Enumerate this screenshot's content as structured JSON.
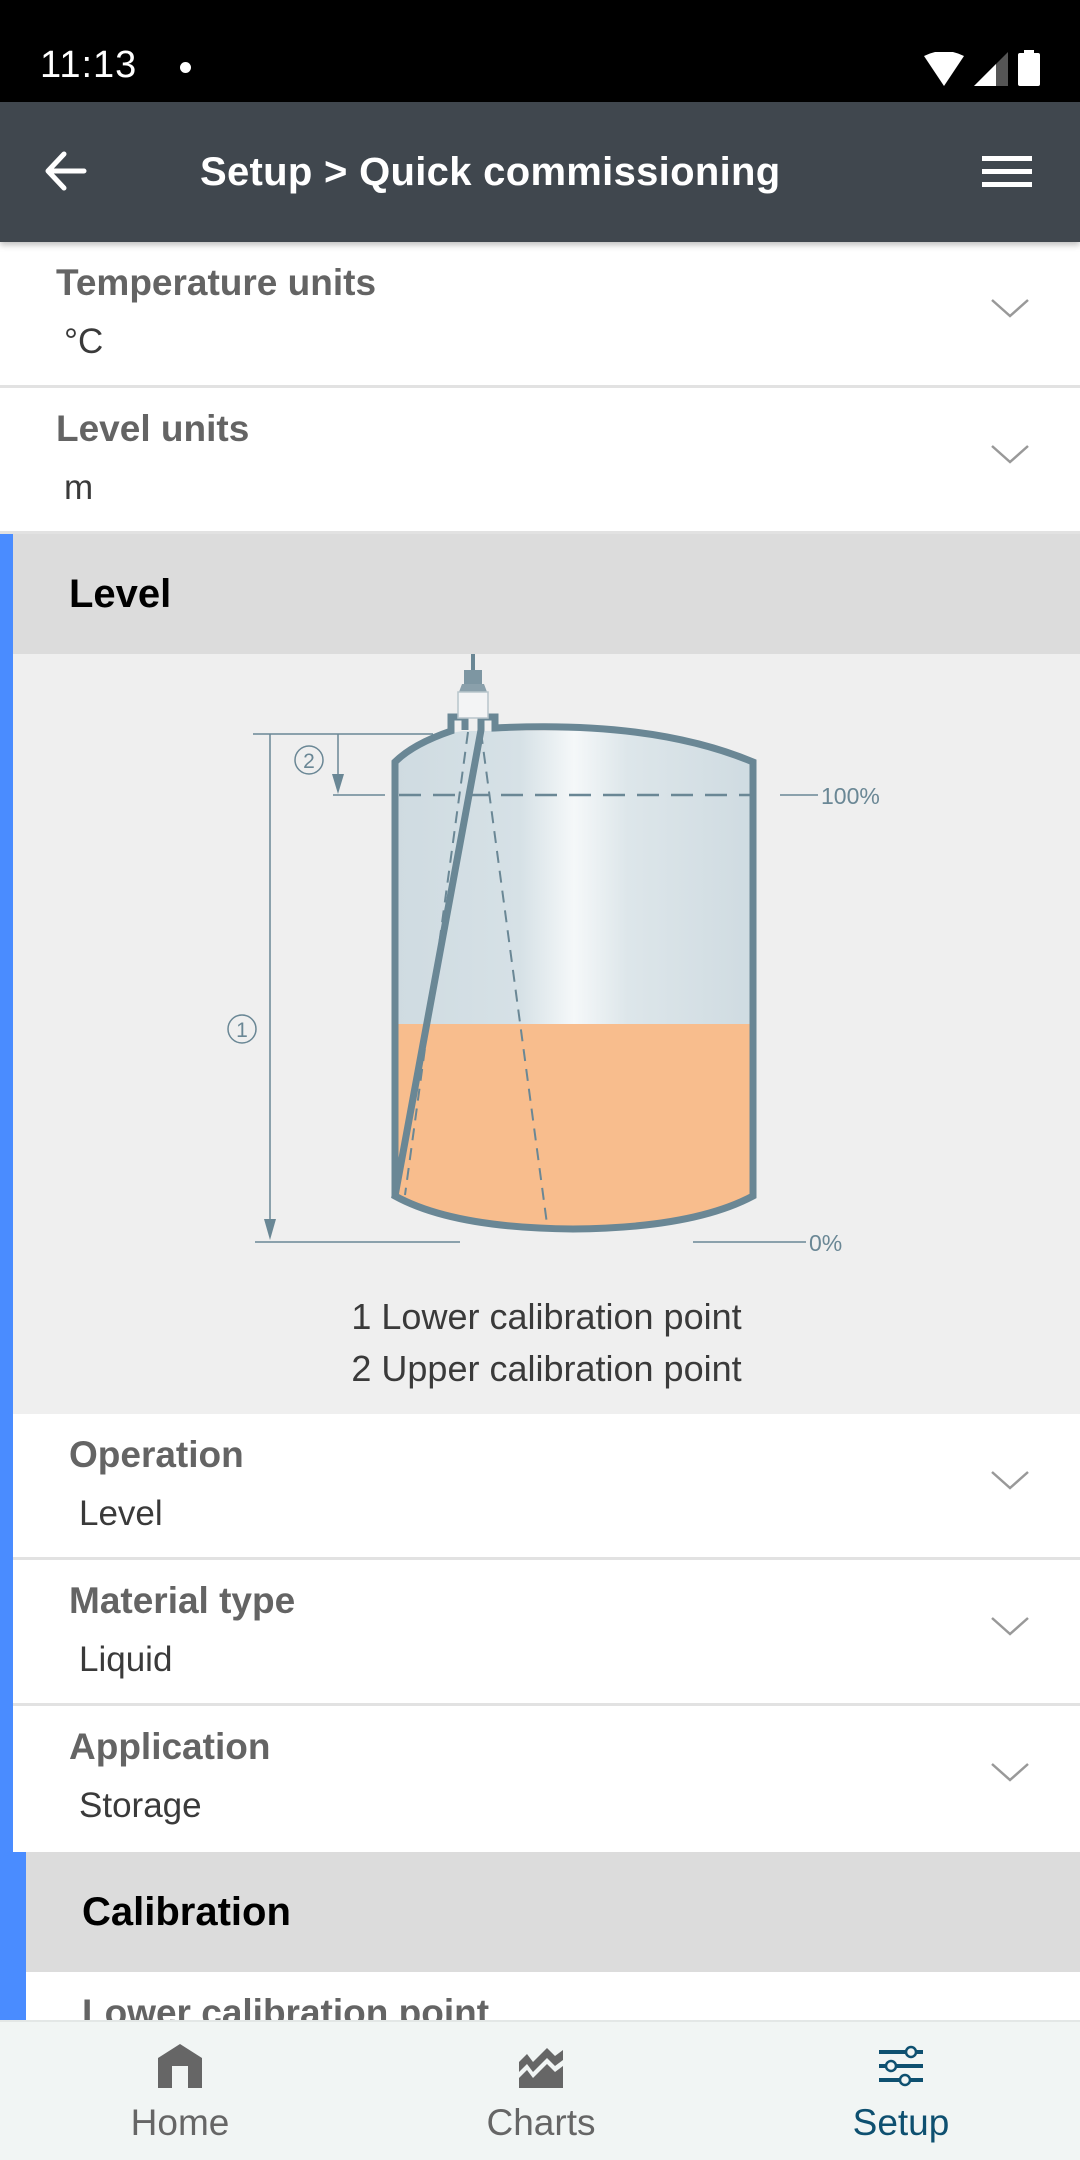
{
  "status_bar": {
    "time": "11:13",
    "icons": [
      "notification-dot",
      "wifi-icon",
      "signal-icon",
      "battery-icon"
    ]
  },
  "app_bar": {
    "title": "Setup > Quick commissioning",
    "back_icon": "arrow-left-icon",
    "menu_icon": "hamburger-menu-icon"
  },
  "fields_top": [
    {
      "label": "Temperature units",
      "value": "°C"
    },
    {
      "label": "Level units",
      "value": "m"
    }
  ],
  "level_section": {
    "title": "Level",
    "diagram": {
      "marker_1": "1",
      "marker_2": "2",
      "label_100": "100%",
      "label_0": "0%",
      "fill_level_fraction": 0.5,
      "colors": {
        "tank_outline": "#6a8795",
        "liquid": "#f8bd8d",
        "tank_air": "#d0dce2"
      }
    },
    "legend": [
      "1 Lower calibration point",
      "2 Upper calibration point"
    ],
    "fields": [
      {
        "label": "Operation",
        "value": "Level"
      },
      {
        "label": "Material type",
        "value": "Liquid"
      },
      {
        "label": "Application",
        "value": "Storage"
      }
    ]
  },
  "calibration_section": {
    "title": "Calibration",
    "partial_field_label": "Lower calibration point"
  },
  "bottom_nav": {
    "items": [
      {
        "label": "Home",
        "icon": "home-icon",
        "active": false
      },
      {
        "label": "Charts",
        "icon": "chart-icon",
        "active": false
      },
      {
        "label": "Setup",
        "icon": "sliders-icon",
        "active": true
      }
    ]
  },
  "colors": {
    "app_bar": "#40474e",
    "accent_blue": "#4a8cff",
    "active_nav": "#0e5070"
  }
}
